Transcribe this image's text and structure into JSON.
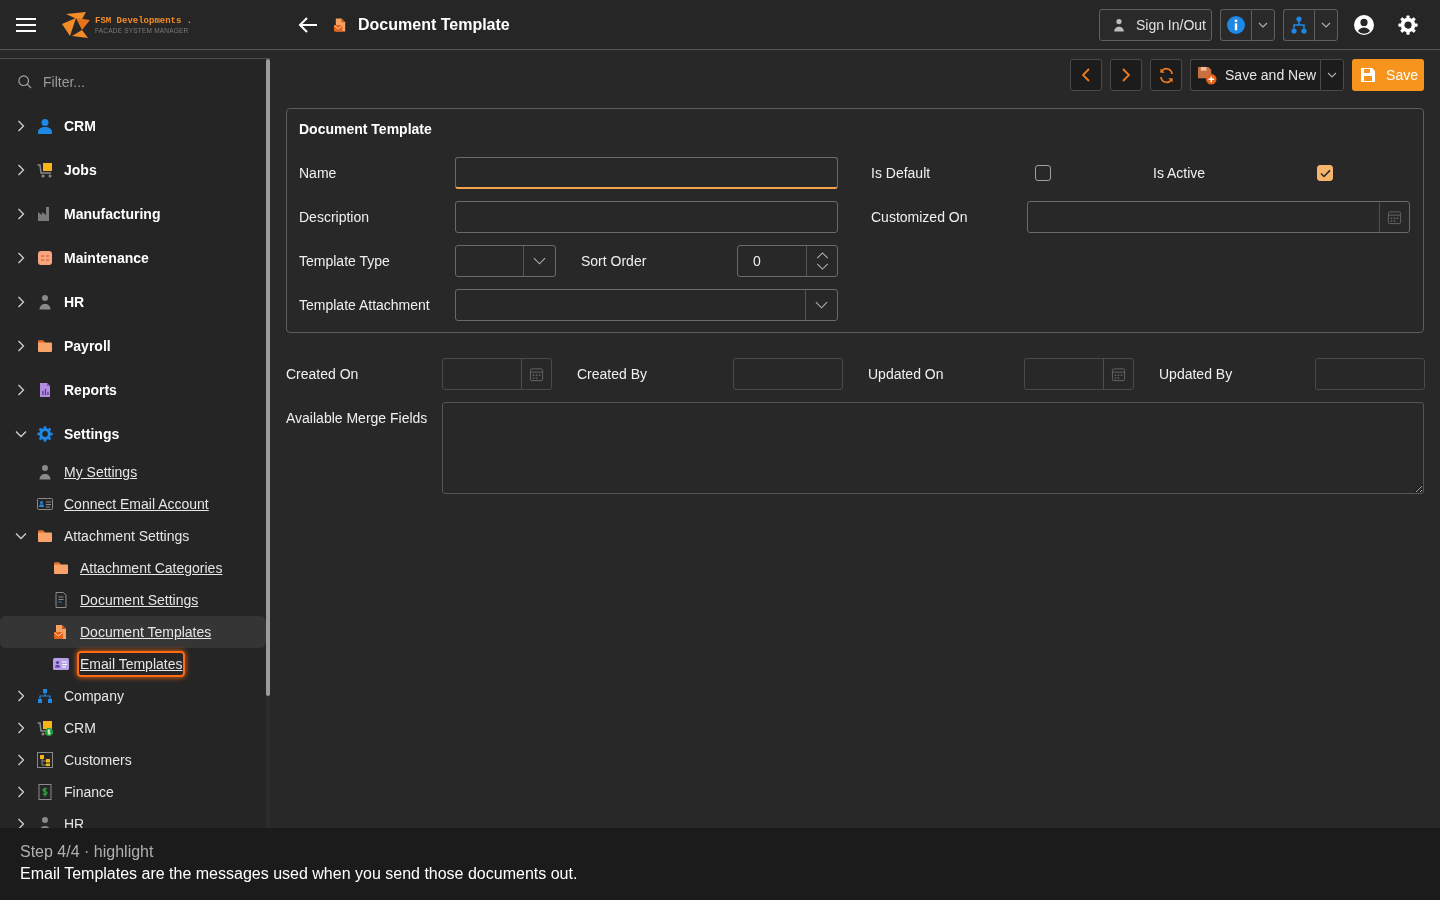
{
  "top_bar": {
    "brand": {
      "name": "FSM Developments .",
      "tagline": "FACADE SYSTEM MANAGER"
    },
    "page_title": "Document Template",
    "sign_in_button": "Sign In/Out"
  },
  "sidebar": {
    "filter": {
      "placeholder": "Filter..."
    },
    "items": [
      {
        "kind": "module",
        "label": "CRM",
        "expanded": false,
        "selected": false,
        "highlighted": false
      },
      {
        "kind": "module",
        "label": "Jobs",
        "expanded": false,
        "selected": false,
        "highlighted": false
      },
      {
        "kind": "module",
        "label": "Manufacturing",
        "expanded": false,
        "selected": false,
        "highlighted": false
      },
      {
        "kind": "module",
        "label": "Maintenance",
        "expanded": false,
        "selected": false,
        "highlighted": false
      },
      {
        "kind": "module",
        "label": "HR",
        "expanded": false,
        "selected": false,
        "highlighted": false
      },
      {
        "kind": "module",
        "label": "Payroll",
        "expanded": false,
        "selected": false,
        "highlighted": false
      },
      {
        "kind": "module",
        "label": "Reports",
        "expanded": false,
        "selected": false,
        "highlighted": false
      },
      {
        "kind": "module",
        "label": "Settings",
        "expanded": true,
        "selected": false,
        "highlighted": false,
        "children": [
          {
            "kind": "link",
            "label": "My Settings",
            "selected": false,
            "highlighted": false
          },
          {
            "kind": "link",
            "label": "Connect Email Account",
            "selected": false,
            "highlighted": false
          },
          {
            "kind": "folder",
            "label": "Attachment Settings",
            "expanded": true,
            "selected": false,
            "highlighted": false,
            "children": [
              {
                "kind": "link",
                "label": "Attachment Categories",
                "selected": false,
                "highlighted": false
              },
              {
                "kind": "link",
                "label": "Document Settings",
                "selected": false,
                "highlighted": false
              },
              {
                "kind": "link",
                "label": "Document Templates",
                "selected": true,
                "highlighted": false
              },
              {
                "kind": "link",
                "label": "Email Templates",
                "selected": false,
                "highlighted": true
              }
            ]
          }
        ]
      },
      {
        "kind": "folder",
        "label": "Company",
        "expanded": false,
        "selected": false,
        "highlighted": false
      },
      {
        "kind": "folder",
        "label": "CRM",
        "expanded": false,
        "selected": false,
        "highlighted": false
      },
      {
        "kind": "folder",
        "label": "Customers",
        "expanded": false,
        "selected": false,
        "highlighted": false
      },
      {
        "kind": "folder",
        "label": "Finance",
        "expanded": false,
        "selected": false,
        "highlighted": false
      },
      {
        "kind": "folder",
        "label": "HR",
        "expanded": false,
        "selected": false,
        "highlighted": false
      }
    ]
  },
  "toolbar": {
    "save_and_new_button": "Save and New",
    "save_button": "Save"
  },
  "form": {
    "title": "Document Template",
    "rows": [
      {
        "left": [
          {
            "kind": "text",
            "label": "Name",
            "focused": true
          }
        ],
        "right": [
          {
            "kind": "checkbox",
            "label": "Is Default",
            "checked": false
          },
          {
            "kind": "checkbox",
            "label": "Is Active",
            "checked": true
          }
        ]
      },
      {
        "left": [
          {
            "kind": "text",
            "label": "Description",
            "focused": false
          }
        ],
        "right": [
          {
            "kind": "date",
            "label": "Customized On"
          }
        ]
      },
      {
        "left": [
          {
            "kind": "select",
            "label": "Template Type"
          },
          {
            "kind": "number",
            "label": "Sort Order",
            "value": "0"
          }
        ]
      },
      {
        "left": [
          {
            "kind": "select",
            "label": "Template Attachment"
          }
        ]
      }
    ]
  },
  "audit_fields": [
    {
      "kind": "date",
      "label": "Created On"
    },
    {
      "kind": "text",
      "label": "Created By",
      "focused": false
    },
    {
      "kind": "date",
      "label": "Updated On"
    },
    {
      "kind": "text",
      "label": "Updated By",
      "focused": false
    }
  ],
  "merge_fields": {
    "label": "Available Merge Fields"
  },
  "tour": {
    "step": "Step 4/4 · highlight",
    "message": "Email Templates are the messages used when you send those documents out."
  }
}
